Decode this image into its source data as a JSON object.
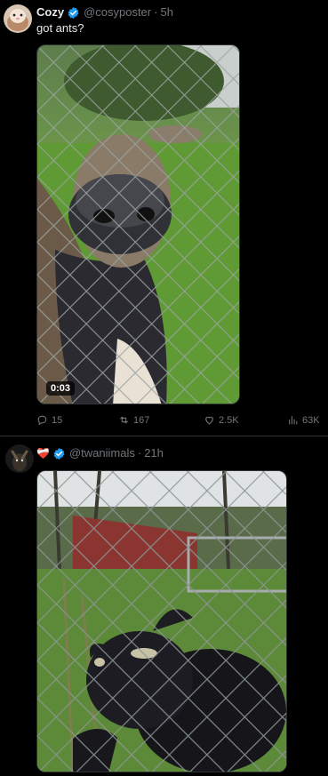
{
  "post1": {
    "name": "Cozy",
    "handle": "@cosyposter",
    "time": "5h",
    "text": "got ants?",
    "video_duration": "0:03",
    "actions": {
      "replies": "15",
      "reposts": "167",
      "likes": "2.5K",
      "views": "63K"
    }
  },
  "post2": {
    "name_emoji": "❤️‍🩹",
    "handle": "@twaniimals",
    "time": "21h"
  },
  "colors": {
    "background": "#000000",
    "text": "#e7e9ea",
    "muted": "#71767b",
    "verified": "#1d9bf0",
    "divider": "#2f3336"
  },
  "icons": [
    "verified-badge-icon",
    "reply-icon",
    "repost-icon",
    "like-icon",
    "views-icon",
    "mending-heart-icon"
  ]
}
